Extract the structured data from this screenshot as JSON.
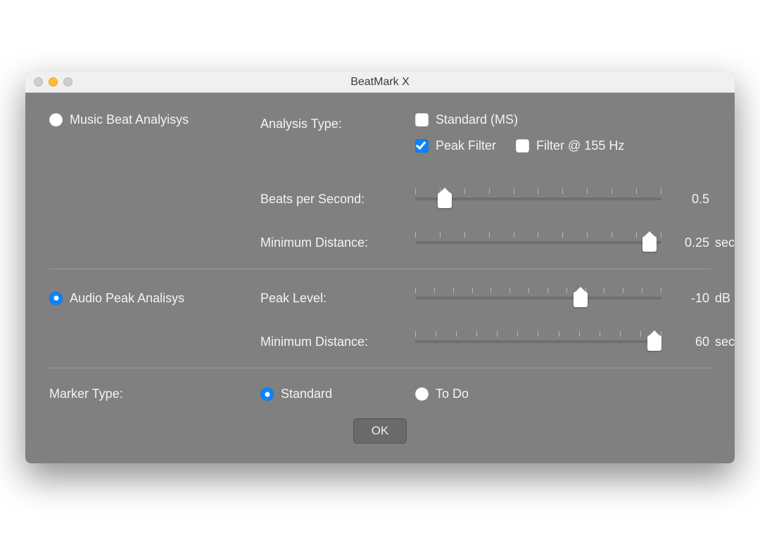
{
  "window": {
    "title": "BeatMark X"
  },
  "section1": {
    "radio_label": "Music Beat Analyisys",
    "radio_checked": false,
    "analysis_type_label": "Analysis Type:",
    "opt_standard": "Standard (MS)",
    "opt_standard_checked": false,
    "opt_peak_filter": "Peak Filter",
    "opt_peak_filter_checked": true,
    "opt_filter155": "Filter @ 155 Hz",
    "opt_filter155_checked": false,
    "bps_label": "Beats per Second:",
    "bps_value": "0.5",
    "bps_ticks": 11,
    "bps_pos_pct": 12,
    "mindist_label": "Minimum Distance:",
    "mindist_value": "0.25",
    "mindist_unit": "secs",
    "mindist_ticks": 11,
    "mindist_pos_pct": 95
  },
  "section2": {
    "radio_label": "Audio Peak Analisys",
    "radio_checked": true,
    "peak_label": "Peak Level:",
    "peak_value": "-10",
    "peak_unit": "dB",
    "peak_ticks": 14,
    "peak_pos_pct": 67,
    "mindist_label": "Minimum Distance:",
    "mindist_value": "60",
    "mindist_unit": "secs",
    "mindist_ticks": 13,
    "mindist_pos_pct": 97
  },
  "marker": {
    "label": "Marker Type:",
    "opt_standard": "Standard",
    "opt_standard_checked": true,
    "opt_todo": "To Do",
    "opt_todo_checked": false
  },
  "ok_label": "OK"
}
